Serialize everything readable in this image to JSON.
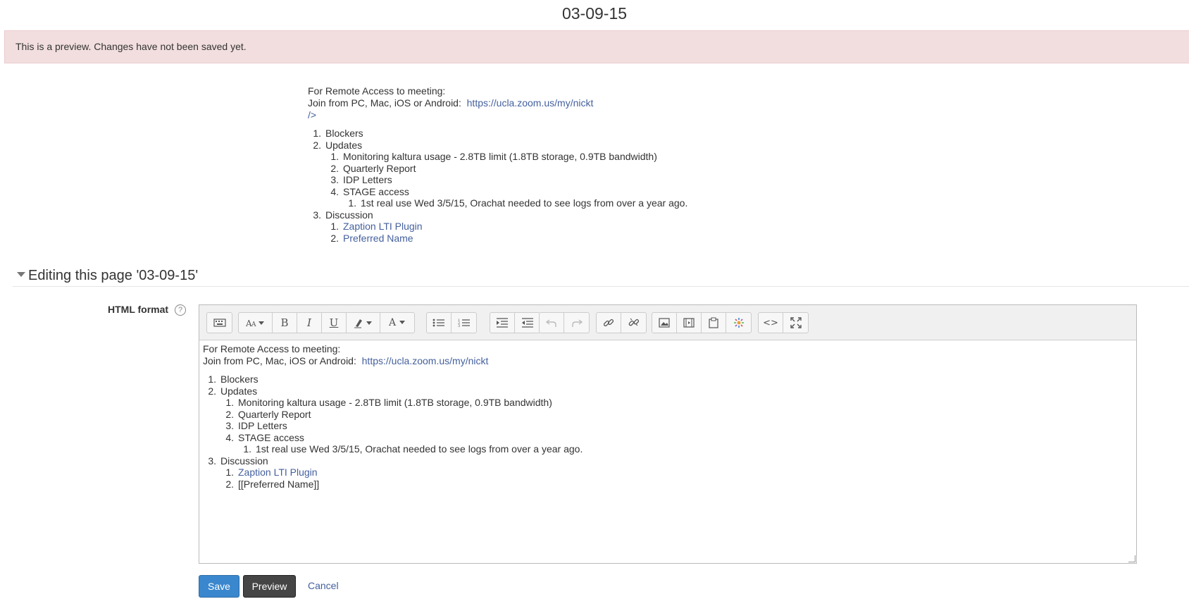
{
  "page": {
    "title": "03-09-15",
    "alert": "This is a preview. Changes have not been saved yet."
  },
  "preview": {
    "line1": "For Remote Access to meeting:",
    "line2_text": "Join from PC, Mac, iOS or Android:  ",
    "line2_link": "https://ucla.zoom.us/my/nickt",
    "line3": "/>",
    "items": {
      "i1": "Blockers",
      "i2": "Updates",
      "i2_1": "Monitoring kaltura usage - 2.8TB limit (1.8TB storage, 0.9TB bandwidth)",
      "i2_2": "Quarterly Report",
      "i2_3": "IDP Letters",
      "i2_4": "STAGE access",
      "i2_4_1": "1st real use Wed 3/5/15, Orachat needed to see logs from over a year ago.",
      "i3": "Discussion",
      "i3_1": "Zaption LTI Plugin",
      "i3_2": "Preferred Name"
    }
  },
  "editing": {
    "heading": "Editing this page '03-09-15'",
    "field_label": "HTML format",
    "help_glyph": "?",
    "content": {
      "line1": "For Remote Access to meeting:",
      "line2_text": "Join from PC, Mac, iOS or Android:  ",
      "line2_link": "https://ucla.zoom.us/my/nickt",
      "i1": "Blockers",
      "i2": "Updates",
      "i2_1": "Monitoring kaltura usage - 2.8TB limit (1.8TB storage, 0.9TB bandwidth)",
      "i2_2": "Quarterly Report",
      "i2_3": "IDP Letters",
      "i2_4": "STAGE access",
      "i2_4_1": "1st real use Wed 3/5/15, Orachat needed to see logs from over a year ago.",
      "i3": "Discussion",
      "i3_1": "Zaption LTI Plugin",
      "i3_2": "[[Preferred Name]]"
    }
  },
  "toolbar": {
    "icons": [
      "keyboard-icon",
      "font-family-icon",
      "bold-icon",
      "italic-icon",
      "underline-icon",
      "highlight-icon",
      "font-color-icon",
      "bullet-list-icon",
      "numbered-list-icon",
      "indent-icon",
      "outdent-icon",
      "undo-icon",
      "redo-icon",
      "link-icon",
      "unlink-icon",
      "image-icon",
      "media-icon",
      "paste-icon",
      "spellcheck-icon",
      "code-icon",
      "fullscreen-icon"
    ],
    "bold_glyph": "B",
    "italic_glyph": "I",
    "underline_glyph": "U",
    "fontcolor_glyph": "A",
    "code_glyph": "<>"
  },
  "buttons": {
    "save": "Save",
    "preview": "Preview",
    "cancel": "Cancel"
  },
  "colors": {
    "alert_bg": "#f2dede",
    "link": "#44609e",
    "save_bg": "#3a87ce",
    "preview_bg": "#454545"
  }
}
